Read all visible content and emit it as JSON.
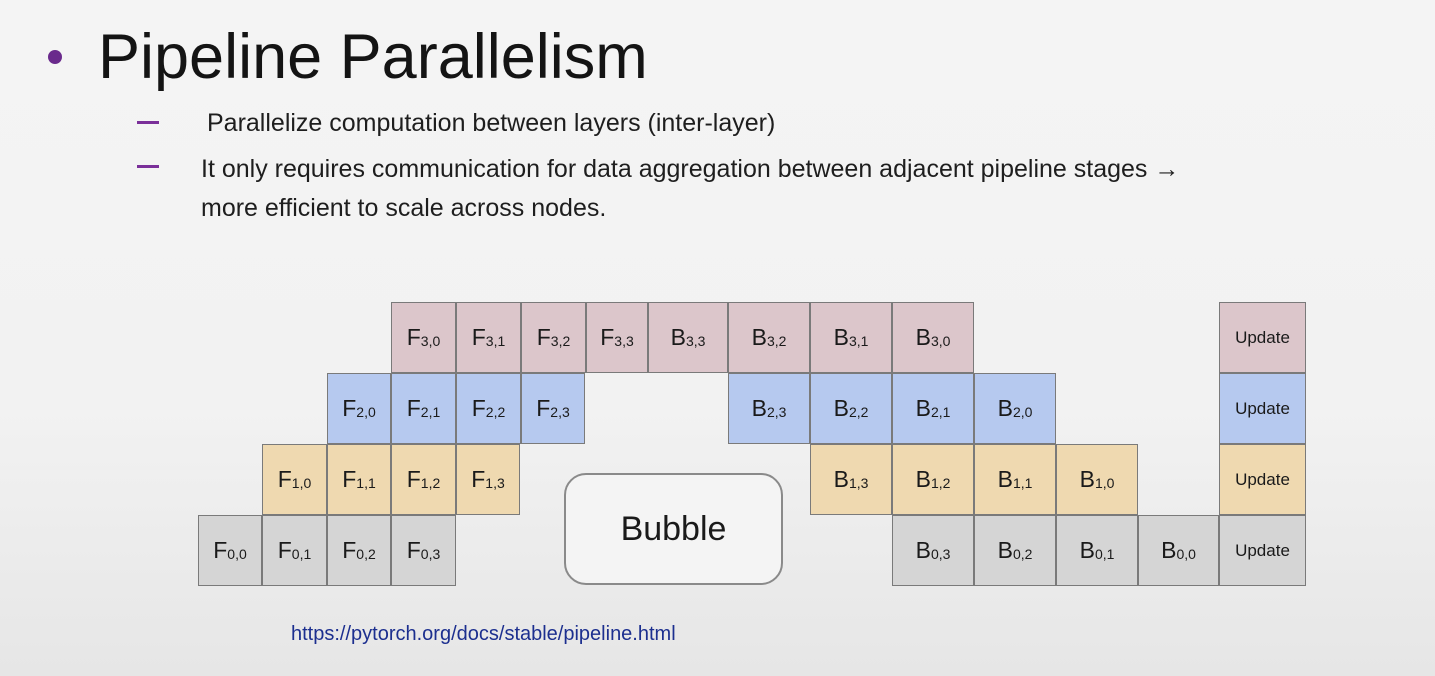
{
  "slide": {
    "title": "Pipeline Parallelism",
    "bullets": [
      "Parallelize computation between layers (inter-layer)",
      "It only requires communication for data aggregation between adjacent pipeline stages →",
      "more efficient to scale across nodes."
    ],
    "bubble_label": "Bubble",
    "link": "https://pytorch.org/docs/stable/pipeline.html"
  },
  "colors": {
    "bullet": "#6a2a8c",
    "gpu0": "#d5d5d5",
    "gpu1": "#efd9b0",
    "gpu2": "#b6c9ef",
    "gpu3": "#dcc6cb",
    "link": "#1c2f8f"
  },
  "schedule": {
    "update_label": "Update",
    "rows": [
      {
        "gpu": 3,
        "forward": [
          "F",
          "3,0",
          "3,1",
          "3,2",
          "3,3"
        ],
        "backward": [
          "B",
          "3,3",
          "3,2",
          "3,1",
          "3,0"
        ]
      },
      {
        "gpu": 2,
        "forward": [
          "F",
          "2,0",
          "2,1",
          "2,2",
          "2,3"
        ],
        "backward": [
          "B",
          "2,3",
          "2,2",
          "2,1",
          "2,0"
        ]
      },
      {
        "gpu": 1,
        "forward": [
          "F",
          "1,0",
          "1,1",
          "1,2",
          "1,3"
        ],
        "backward": [
          "B",
          "1,3",
          "1,2",
          "1,1",
          "1,0"
        ]
      },
      {
        "gpu": 0,
        "forward": [
          "F",
          "0,0",
          "0,1",
          "0,2",
          "0,3"
        ],
        "backward": [
          "B",
          "0,3",
          "0,2",
          "0,1",
          "0,0"
        ]
      }
    ]
  }
}
